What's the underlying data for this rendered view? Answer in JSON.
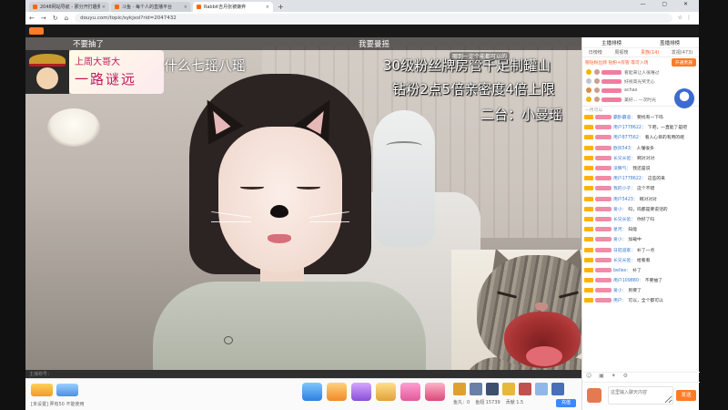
{
  "browser": {
    "tabs": [
      {
        "label": "2048网站导航 - 那分开打趣我说"
      },
      {
        "label": "斗鱼 - 每个人的直播平台"
      },
      {
        "label": "Rabbit吉月张被嫌弃"
      }
    ],
    "new_tab": "+",
    "url": "douyu.com/topic/sykjxsl?rid=2047432"
  },
  "stream": {
    "caption_left": "不要抽了",
    "caption_mid": "我要曼摇",
    "banner_line1": "上周大哥大",
    "banner_line2": "一路谜远",
    "title": "什么七瑶八瑶",
    "info_lines": [
      "30级粉丝牌房管千足制罐山",
      "钻粉2点5倍亲密度4倍上限",
      "二台：小曼瑶"
    ],
    "danmaku": "哪到一定个能都可以的"
  },
  "status_line": "主播称号：",
  "giftbar": {
    "note": "[未设置] 弄有50 不能使用",
    "bottom": [
      "鱼丸：0",
      "鱼翅 15739",
      "贡献 1.5"
    ],
    "recharge": "充值"
  },
  "panel": {
    "rank_head": [
      "主播排榜",
      "盖播排榜"
    ],
    "rank_tabs": [
      "日榜榜",
      "周视榜",
      "贵族(14)",
      "发视(473)"
    ],
    "promo_text": "赠钻粉丝牌 钻粉+房管 等可入场",
    "promo_btn": "开通贵族",
    "rank_rows": [
      "看起来让人很难过",
      "好视高光奖无心",
      "achax",
      "美好... 一次时光"
    ],
    "divider": "一月可以",
    "messages": [
      {
        "nick": "霸卧霸道：",
        "text": "要找有一下吗"
      },
      {
        "nick": "用户1778622：",
        "text": "下吧，一直能了是吧"
      },
      {
        "nick": "用户877562：",
        "text": "看人心目的有用的呢"
      },
      {
        "nick": "欧风543：",
        "text": "人懂很多"
      },
      {
        "nick": "长兄长爸：",
        "text": "啊对对对"
      },
      {
        "nick": "没脾气：",
        "text": "我还是说"
      },
      {
        "nick": "用户1778622：",
        "text": "这些的来"
      },
      {
        "nick": "我的小子：",
        "text": "这个不错"
      },
      {
        "nick": "用户5423：",
        "text": "啊对对对"
      },
      {
        "nick": "爱小：",
        "text": "吗，吗都是要说话的"
      },
      {
        "nick": "长兄长爸：",
        "text": "你好了吗"
      },
      {
        "nick": "星河：",
        "text": "知能"
      },
      {
        "nick": "爱小：",
        "text": "加载中"
      },
      {
        "nick": "日冠道家：",
        "text": "补了一点"
      },
      {
        "nick": "长兄长爸：",
        "text": "给看看"
      },
      {
        "nick": "bellex：",
        "text": "补了"
      },
      {
        "nick": "用户109880：",
        "text": "不要抽了"
      },
      {
        "nick": "爱小：",
        "text": "到要了"
      },
      {
        "nick": "用户：",
        "text": "可以，全个都可以"
      }
    ],
    "input_placeholder": "这里输入聊天内容",
    "send": "发送"
  }
}
